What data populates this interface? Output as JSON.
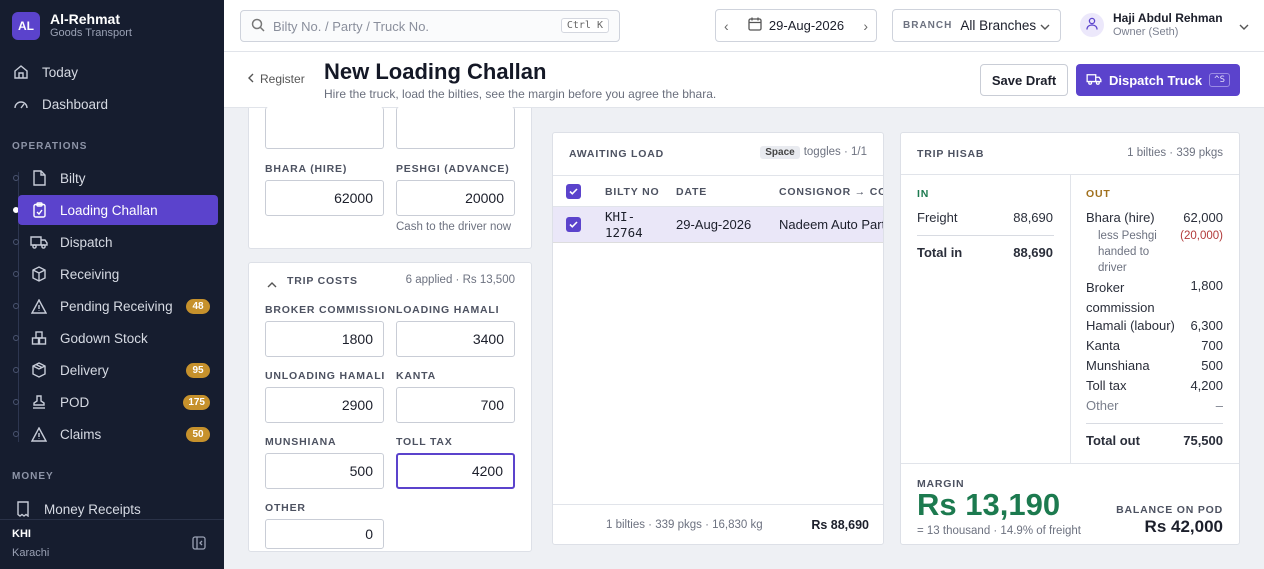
{
  "brand": {
    "mark": "AL",
    "name": "Al-Rehmat",
    "sub": "Goods Transport"
  },
  "nav_top": [
    {
      "label": "Today",
      "icon": "home-icon"
    },
    {
      "label": "Dashboard",
      "icon": "gauge-icon"
    }
  ],
  "sections": {
    "operations": "OPERATIONS",
    "money": "MONEY"
  },
  "nav_ops": [
    {
      "label": "Bilty",
      "icon": "document-icon"
    },
    {
      "label": "Loading Challan",
      "icon": "clipboard-icon",
      "active": true
    },
    {
      "label": "Dispatch",
      "icon": "truck-icon"
    },
    {
      "label": "Receiving",
      "icon": "box-icon"
    },
    {
      "label": "Pending Receiving",
      "icon": "warning-icon",
      "badge": "48"
    },
    {
      "label": "Godown Stock",
      "icon": "boxes-icon"
    },
    {
      "label": "Delivery",
      "icon": "package-icon",
      "badge": "95"
    },
    {
      "label": "POD",
      "icon": "stamp-icon",
      "badge": "175"
    },
    {
      "label": "Claims",
      "icon": "alert-icon",
      "badge": "50"
    }
  ],
  "nav_money": [
    {
      "label": "Money Receipts",
      "icon": "receipt-icon"
    }
  ],
  "footer": {
    "code": "KHI",
    "city": "Karachi"
  },
  "search": {
    "placeholder": "Bilty No. / Party / Truck No.",
    "shortcut": "Ctrl K"
  },
  "date": {
    "value": "29-Aug-2026",
    "prev": "‹",
    "next": "›"
  },
  "branch": {
    "label": "BRANCH",
    "value": "All Branches"
  },
  "user": {
    "name": "Haji Abdul Rehman",
    "role": "Owner (Seth)"
  },
  "header": {
    "back": "Register",
    "title": "New Loading Challan",
    "subtitle": "Hire the truck, load the bilties, see the margin before you agree the bhara.",
    "save_label": "Save Draft",
    "dispatch_label": "Dispatch Truck",
    "dispatch_shortcut": "^S"
  },
  "hire": {
    "bhara_label": "BHARA (HIRE)",
    "bhara_value": "62000",
    "peshgi_label": "PESHGI (ADVANCE)",
    "peshgi_value": "20000",
    "peshgi_hint": "Cash to the driver now"
  },
  "trip_costs": {
    "title": "TRIP COSTS",
    "summary": "6 applied · Rs 13,500",
    "fields": [
      {
        "label": "BROKER COMMISSION",
        "value": "1800"
      },
      {
        "label": "LOADING HAMALI",
        "value": "3400"
      },
      {
        "label": "UNLOADING HAMALI",
        "value": "2900"
      },
      {
        "label": "KANTA",
        "value": "700"
      },
      {
        "label": "MUNSHIANA",
        "value": "500"
      },
      {
        "label": "TOLL TAX",
        "value": "4200"
      },
      {
        "label": "OTHER",
        "value": "0"
      }
    ]
  },
  "awaiting": {
    "title": "AWAITING LOAD",
    "key": "Space",
    "toggle_text": "toggles · 1/1",
    "columns": [
      "BILTY NO",
      "DATE",
      "CONSIGNOR → CONSIGNEE"
    ],
    "rows": [
      {
        "bilty_line1": "KHI-",
        "bilty_line2": "12764",
        "date": "29-Aug-2026",
        "consignor": "Nadeem Auto Parts"
      }
    ],
    "footer_stats": "1 bilties · 339 pkgs · 16,830 kg",
    "footer_total": "Rs 88,690"
  },
  "hisab": {
    "title": "TRIP HISAB",
    "summary": "1 bilties · 339 pkgs",
    "in_label": "IN",
    "out_label": "OUT",
    "in_rows": [
      {
        "label": "Freight",
        "value": "88,690"
      }
    ],
    "total_in_label": "Total in",
    "total_in": "88,690",
    "bhara_label": "Bhara (hire)",
    "bhara_value": "62,000",
    "peshgi_note": "less Peshgi handed to driver",
    "peshgi_value": "(20,000)",
    "out_rows": [
      {
        "label": "Broker commission",
        "value": "1,800"
      },
      {
        "label": "Hamali (labour)",
        "value": "6,300"
      },
      {
        "label": "Kanta",
        "value": "700"
      },
      {
        "label": "Munshiana",
        "value": "500"
      },
      {
        "label": "Toll tax",
        "value": "4,200"
      },
      {
        "label": "Other",
        "value": "–"
      }
    ],
    "total_out_label": "Total out",
    "total_out": "75,500",
    "margin_label": "MARGIN",
    "margin_value": "Rs 13,190",
    "margin_note": "= 13 thousand · 14.9% of freight",
    "balance_label": "BALANCE ON POD",
    "balance_value": "Rs 42,000"
  },
  "colors": {
    "accent": "#5b43cc",
    "sidebar": "#161d2f",
    "badge": "#c6912c",
    "margin": "#1c7a4f",
    "negative": "#b23a3a"
  }
}
